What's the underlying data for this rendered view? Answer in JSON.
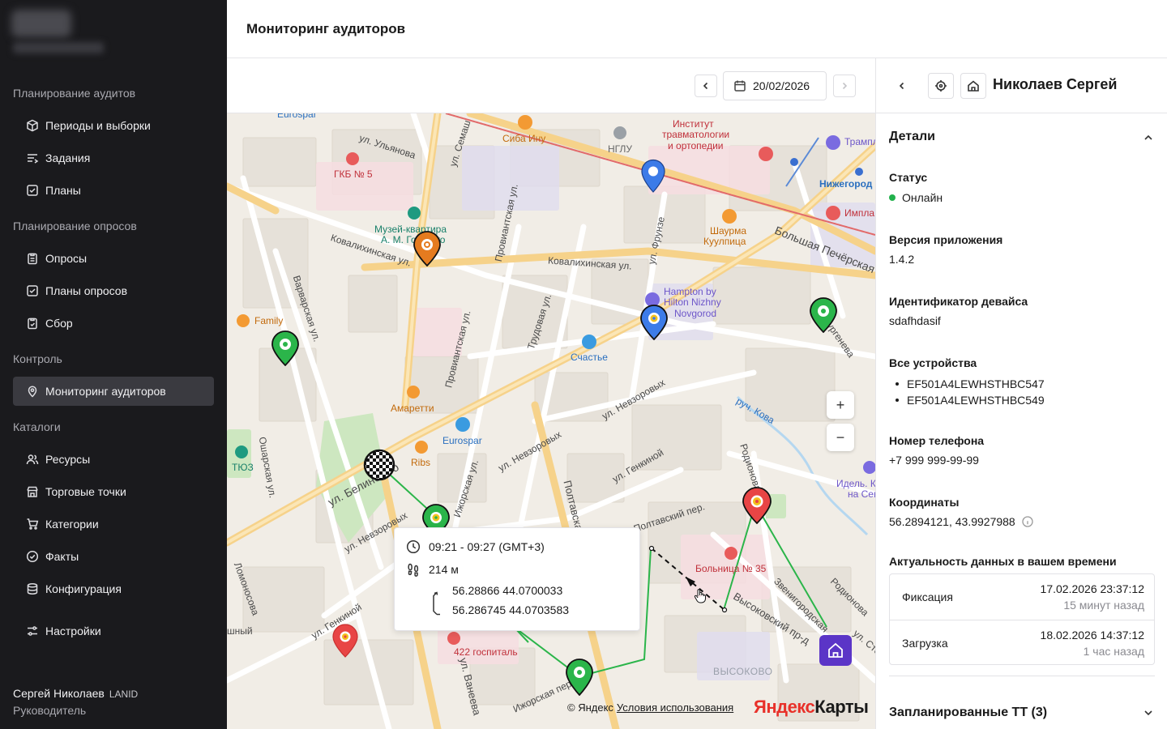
{
  "app": {
    "page_title": "Мониторинг аудиторов"
  },
  "sidebar": {
    "sections": [
      {
        "title": "Планирование аудитов",
        "items": [
          {
            "label": "Периоды и выборки",
            "icon": "cube-icon"
          },
          {
            "label": "Задания",
            "icon": "list-arrow-icon"
          },
          {
            "label": "Планы",
            "icon": "checkbox-icon"
          }
        ]
      },
      {
        "title": "Планирование опросов",
        "items": [
          {
            "label": "Опросы",
            "icon": "clipboard-icon"
          },
          {
            "label": "Планы опросов",
            "icon": "checkbox-icon"
          },
          {
            "label": "Сбор",
            "icon": "clipboard-check-icon"
          }
        ]
      },
      {
        "title": "Контроль",
        "items": [
          {
            "label": "Мониторинг аудиторов",
            "icon": "location-pin-icon",
            "active": true
          }
        ]
      },
      {
        "title": "Каталоги",
        "items": [
          {
            "label": "Ресурсы",
            "icon": "users-icon"
          },
          {
            "label": "Торговые точки",
            "icon": "store-icon"
          },
          {
            "label": "Категории",
            "icon": "cart-icon"
          },
          {
            "label": "Факты",
            "icon": "check-circle-icon"
          },
          {
            "label": "Конфигурация",
            "icon": "database-icon"
          }
        ]
      }
    ],
    "settings_label": "Настройки",
    "user": {
      "name": "Сергей Николаев",
      "org": "LANID",
      "role": "Руководитель"
    }
  },
  "toolbar": {
    "date": "20/02/2026"
  },
  "map": {
    "labels": {
      "eurospar_top": "Eurospar",
      "ulyanova": "ул. Ульянова",
      "gkb5": "ГКБ № 5",
      "semashko": "ул. Семаш",
      "siba": "Сиба Ину",
      "nglu": "НГЛУ",
      "institute1": "Институт",
      "institute2": "травматологии",
      "institute3": "и ортопедии",
      "trampoline": "Трамплин",
      "nizhegorod": "Нижегород",
      "impla": "Импла",
      "museum1": "Музей-квартира",
      "museum2": "А. М. Горького",
      "kovalikh1": "Ковалихинская ул.",
      "kovalikh2": "Ковалихинская ул.",
      "provi": "Провиантская ул.",
      "frunze": "ул. Фрунзе",
      "shaurma1": "Шаурма",
      "shaurma2": "Куулпица",
      "bolshaya": "Большая Печёрская",
      "hampton1": "Hampton by",
      "hampton2": "Hilton Nizhny",
      "hampton3": "Novgorod",
      "family": "Family",
      "varvar": "Варварская ул.",
      "turgeneva": "ул. Тургенева",
      "schaste": "Счастье",
      "trudovaya": "Трудовая ул.",
      "provi2": "Провиантская ул.",
      "amaretti": "Амаретти",
      "nevzor1": "ул. Невзоровых",
      "ruch": "руч. Кова",
      "eurospar2": "Eurospar",
      "ribs": "Ribs",
      "tyuz": "ТЮЗ",
      "osharsk": "Ошарская ул.",
      "belin": "ул. Белинского",
      "izhorsk": "Ижорская ул.",
      "nevzor2": "ул. Невзоровых",
      "genkina1": "ул. Генкиной",
      "poltav": "Полтавская",
      "poltav2": "Полтавский пер.",
      "rodionova": "Родионова",
      "idel1": "Идель. К",
      "idel2": "на Сен",
      "nevzor3": "ул. Невзоровых",
      "lomonos": "Ломоносова",
      "bolnica": "Больница № 35",
      "vysokovsky": "Высоковский пр-д",
      "zvenigor": "Звенигородская",
      "rodionova2": "Родионова",
      "genkina2": "ул. Генкиной",
      "hosp422": "422 госпиталь",
      "vaneeva": "ул. Ванеева",
      "izhorsk2": "Ижорская пер.",
      "vysokovo": "ВЫСОКОВО",
      "shny": "шный",
      "ste": "ул. Сте"
    },
    "tooltip": {
      "time": "09:21 - 09:27 (GMT+3)",
      "distance": "214 м",
      "coord_start": "56.28866 44.0700033",
      "coord_end": "56.286745 44.0703583"
    },
    "attribution": "© Яндекс",
    "terms_link": "Условия использования",
    "logo_y": "Яндекс",
    "logo_rest": "Карты",
    "zoom_in": "+",
    "zoom_out": "−"
  },
  "panel": {
    "name": "Николаев Сергей",
    "details_title": "Детали",
    "status_label": "Статус",
    "status_value": "Онлайн",
    "version_label": "Версия приложения",
    "version_value": "1.4.2",
    "device_label": "Идентификатор девайса",
    "device_value": "sdafhdasif",
    "all_devices_label": "Все устройства",
    "devices": [
      "EF501A4LEWHSTHBC547",
      "EF501A4LEWHSTHBC549"
    ],
    "phone_label": "Номер телефона",
    "phone_value": "+7 999 999-99-99",
    "coords_label": "Координаты",
    "coords_value": "56.2894121, 43.9927988",
    "freshness_label": "Актуальность данных в вашем времени",
    "freshness": [
      {
        "label": "Фиксация",
        "time": "17.02.2026 23:37:12",
        "ago": "15 минут назад"
      },
      {
        "label": "Загрузка",
        "time": "18.02.2026 14:37:12",
        "ago": "1 час назад"
      }
    ],
    "planned_label": "Запланированные ТТ (3)"
  },
  "colors": {
    "sidebar_bg": "#1a1a1d",
    "status_online": "#22b14c",
    "home_marker": "#5b35c7",
    "route_line": "#2bb54a"
  }
}
